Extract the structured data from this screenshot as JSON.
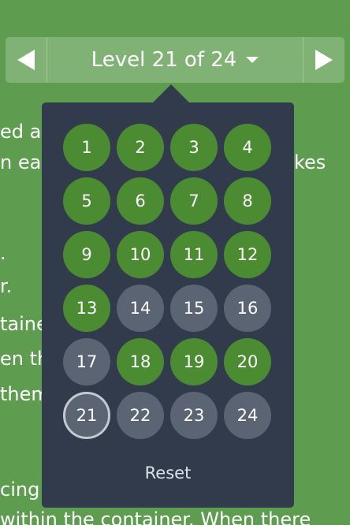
{
  "background_text": [
    "ed at",
    "n eac",
    "kes",
    ".",
    "r.",
    "taine",
    "en th",
    "them",
    "cing",
    " within the container. When there"
  ],
  "nav": {
    "title": "Level 21 of 24",
    "prev_icon": "triangle-left-icon",
    "next_icon": "triangle-right-icon",
    "dropdown_icon": "caret-down-icon"
  },
  "levels": [
    {
      "label": "1",
      "status": "done"
    },
    {
      "label": "2",
      "status": "done"
    },
    {
      "label": "3",
      "status": "done"
    },
    {
      "label": "4",
      "status": "done"
    },
    {
      "label": "5",
      "status": "done"
    },
    {
      "label": "6",
      "status": "done"
    },
    {
      "label": "7",
      "status": "done"
    },
    {
      "label": "8",
      "status": "done"
    },
    {
      "label": "9",
      "status": "done"
    },
    {
      "label": "10",
      "status": "done"
    },
    {
      "label": "11",
      "status": "done"
    },
    {
      "label": "12",
      "status": "done"
    },
    {
      "label": "13",
      "status": "done"
    },
    {
      "label": "14",
      "status": "todo"
    },
    {
      "label": "15",
      "status": "todo"
    },
    {
      "label": "16",
      "status": "todo"
    },
    {
      "label": "17",
      "status": "todo"
    },
    {
      "label": "18",
      "status": "done"
    },
    {
      "label": "19",
      "status": "done"
    },
    {
      "label": "20",
      "status": "done"
    },
    {
      "label": "21",
      "status": "current"
    },
    {
      "label": "22",
      "status": "todo"
    },
    {
      "label": "23",
      "status": "todo"
    },
    {
      "label": "24",
      "status": "todo"
    }
  ],
  "reset_label": "Reset",
  "colors": {
    "background": "#5e9d4f",
    "panel": "#323b4c",
    "level_done": "#4b8c33",
    "level_todo": "#5b6473",
    "level_current_ring": "#c4c8d0"
  }
}
